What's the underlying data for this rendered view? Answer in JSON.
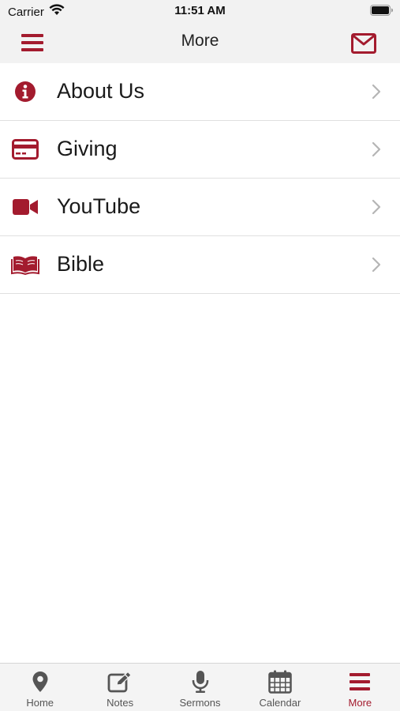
{
  "status_bar": {
    "carrier": "Carrier",
    "time": "11:51 AM"
  },
  "nav": {
    "title": "More",
    "menu_icon": "hamburger-icon",
    "mail_icon": "envelope-icon"
  },
  "menu_items": [
    {
      "label": "About Us",
      "icon": "info-circle-icon"
    },
    {
      "label": "Giving",
      "icon": "credit-card-icon"
    },
    {
      "label": "YouTube",
      "icon": "video-camera-icon"
    },
    {
      "label": "Bible",
      "icon": "open-book-icon"
    }
  ],
  "tabs": [
    {
      "label": "Home",
      "icon": "map-pin-icon",
      "active": false
    },
    {
      "label": "Notes",
      "icon": "edit-note-icon",
      "active": false
    },
    {
      "label": "Sermons",
      "icon": "microphone-icon",
      "active": false
    },
    {
      "label": "Calendar",
      "icon": "calendar-icon",
      "active": false
    },
    {
      "label": "More",
      "icon": "hamburger-icon",
      "active": true
    }
  ],
  "colors": {
    "accent": "#a31b2e",
    "tab_inactive": "#555555",
    "bar_background": "#f2f2f2"
  }
}
